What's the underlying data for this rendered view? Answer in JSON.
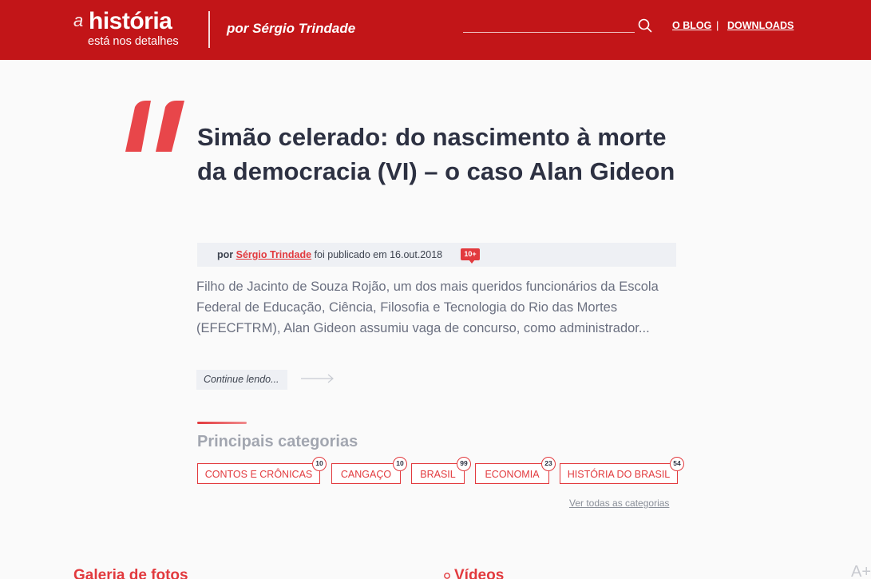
{
  "header": {
    "logo_prefix": "a",
    "logo_brand": "história",
    "logo_tagline": "está nos detalhes",
    "author_line": "por Sérgio  Trindade",
    "search_placeholder": "",
    "nav": {
      "blog": "O BLOG",
      "separator": "|",
      "downloads": "DOWNLOADS"
    },
    "colors": {
      "background": "#c21518"
    },
    "icons": {
      "search": "search-icon"
    }
  },
  "article": {
    "title": "Simão celerado: do nascimento à morte da democracia (VI) – o caso Alan Gideon",
    "meta": {
      "by": "por",
      "author": "Sérgio Trindade",
      "published_text": "foi publicado em 16.out.2018",
      "comments_badge": "10+"
    },
    "excerpt": "Filho de Jacinto de Souza Rojão, um dos mais queridos funcionários da Escola Federal de Educação, Ciência, Filosofia e Tecnologia do Rio das Mortes (EFECFTRM), Alan Gideon assumiu vaga de concurso, como administrador...",
    "continue_label": "Continue lendo...",
    "accent": "#e23a3e"
  },
  "categories": {
    "heading": "Principais categorias",
    "items": [
      {
        "label": "CONTOS E CRÔNICAS",
        "count": "10"
      },
      {
        "label": "CANGAÇO",
        "count": "10"
      },
      {
        "label": "BRASIL",
        "count": "99"
      },
      {
        "label": "ECONOMIA",
        "count": "23"
      },
      {
        "label": "HISTÓRIA DO BRASIL",
        "count": "54"
      }
    ],
    "see_all": "Ver todas as categorias"
  },
  "bottom": {
    "gallery_heading": "Galeria de fotos",
    "videos_heading": "Vídeos",
    "font_size_control": "A+"
  }
}
